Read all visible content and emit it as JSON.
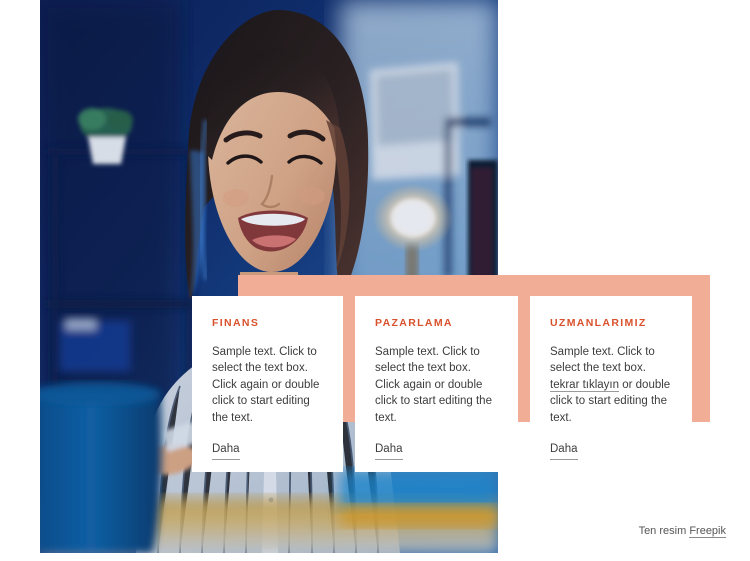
{
  "colors": {
    "accent_peach": "#F2AD96",
    "heading_orange": "#D9512C",
    "body_text": "#3d3d3d",
    "page_background": "#ffffff"
  },
  "photo": {
    "alt": "Smiling young woman with dark hair in a white pinstriped shirt sitting in a blue-lit office at night, shelving with a potted plant behind her, a warm glowing desk lamp and monitor to the right, blue mug in the foreground"
  },
  "cards": [
    {
      "title": "FINANS",
      "body_before_link": "Sample text. Click to select the text box. Click again or double click to start editing the text.",
      "link_text": "",
      "body_after_link": "",
      "more_label": "Daha"
    },
    {
      "title": "PAZARLAMA",
      "body_before_link": "Sample text. Click to select the text box. Click again or double click to start editing the text.",
      "link_text": "",
      "body_after_link": "",
      "more_label": "Daha"
    },
    {
      "title": "UZMANLARIMIZ",
      "body_before_link": "Sample text. Click to select the text box. ",
      "link_text": "tekrar tıklayın",
      "body_after_link": " or double click to start editing the text.",
      "more_label": "Daha"
    }
  ],
  "footer": {
    "credit_prefix": "Ten resim ",
    "credit_link": "Freepik"
  }
}
